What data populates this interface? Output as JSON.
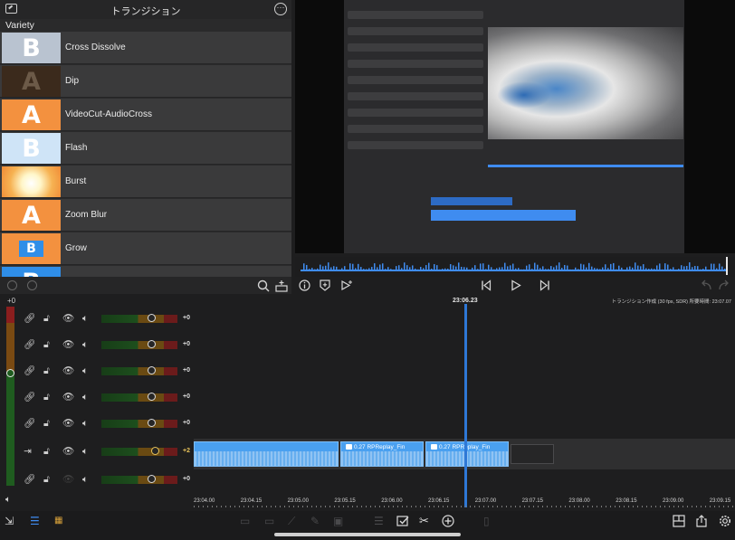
{
  "transitions": {
    "title": "トランジション",
    "category": "Variety",
    "items": [
      {
        "label": "Cross Dissolve",
        "letter": "B",
        "bg": "#b9c3d0",
        "fg": "#ffffff"
      },
      {
        "label": "Dip",
        "letter": "A",
        "bg": "#3b2a1c",
        "fg": "#6c5a48"
      },
      {
        "label": "VideoCut-AudioCross",
        "letter": "A",
        "bg": "#f3913f",
        "fg": "#ffffff"
      },
      {
        "label": "Flash",
        "letter": "B",
        "bg": "#cfe4f7",
        "fg": "#ffffff"
      },
      {
        "label": "Burst",
        "letter": "",
        "bg": "#f6b252",
        "fg": "#ffffff"
      },
      {
        "label": "Zoom Blur",
        "letter": "A",
        "bg": "#f3913f",
        "fg": "#ffffff"
      },
      {
        "label": "Grow",
        "letter": "B",
        "bg": "#f3913f",
        "fg": "#ffffff"
      },
      {
        "label": "",
        "letter": "B",
        "bg": "#2f8ee8",
        "fg": "#ffffff"
      }
    ]
  },
  "master": {
    "value": "+0"
  },
  "tracks": [
    {
      "value": "+0",
      "selected": false,
      "knob": 0.65
    },
    {
      "value": "+0",
      "selected": false,
      "knob": 0.65
    },
    {
      "value": "+0",
      "selected": false,
      "knob": 0.65
    },
    {
      "value": "+0",
      "selected": false,
      "knob": 0.65
    },
    {
      "value": "+0",
      "selected": false,
      "knob": 0.65
    },
    {
      "value": "+2",
      "selected": true,
      "knob": 0.7
    },
    {
      "value": "+0",
      "selected": false,
      "knob": 0.65
    }
  ],
  "timeline": {
    "current_time": "23:06.23",
    "project_info": "トランジション作成 (30 fps, SDR)  所要時間: 23:07.07",
    "clips": [
      {
        "label": ""
      },
      {
        "label": "0.27  RPReplay_Fin"
      },
      {
        "label": "0.27  RPReplay_Fin"
      }
    ],
    "ruler": [
      "23:04.00",
      "23:04.15",
      "23:05.00",
      "23:05.15",
      "23:06.00",
      "23:06.15",
      "23:07.00",
      "23:07.15",
      "23:08.00",
      "23:08.15",
      "23:09.00",
      "23:09.15"
    ]
  },
  "colors": {
    "accent": "#3f8cf0",
    "playhead": "#2e78d6",
    "panel": "#2a2a2b",
    "clip": "#4aa0f0"
  }
}
